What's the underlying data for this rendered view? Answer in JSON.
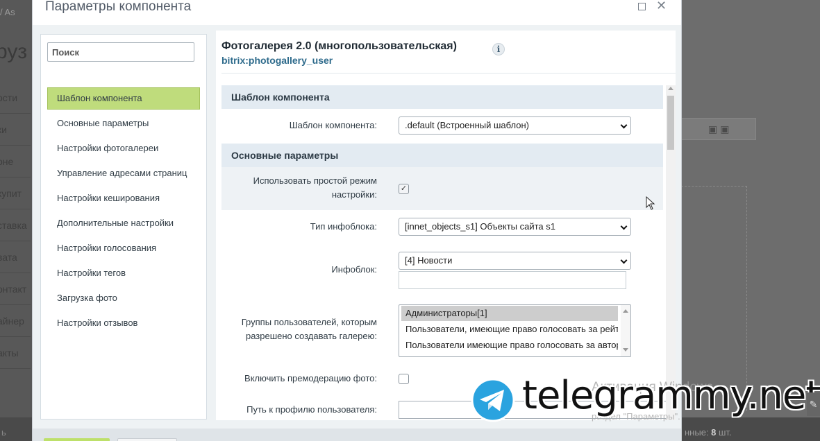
{
  "background": {
    "breadcrumb": "/ As",
    "heading": "руз",
    "nav_items": [
      "ости",
      "ки",
      "оне",
      "купит",
      "ставка",
      "вата",
      "онтакт",
      "айнер",
      "акты"
    ],
    "bottom_left": "ь",
    "bottom_right_prefix": "нные:",
    "bottom_right_value": "8",
    "bottom_right_suffix": "шт."
  },
  "dialog": {
    "title": "Параметры компонента",
    "search_placeholder": "Поиск",
    "nav": [
      {
        "label": "Шаблон компонента",
        "active": true
      },
      {
        "label": "Основные параметры",
        "active": false
      },
      {
        "label": "Настройки фотогалереи",
        "active": false
      },
      {
        "label": "Управление адресами страниц",
        "active": false
      },
      {
        "label": "Настройки кеширования",
        "active": false
      },
      {
        "label": "Дополнительные настройки",
        "active": false
      },
      {
        "label": "Настройки голосования",
        "active": false
      },
      {
        "label": "Настройки тегов",
        "active": false
      },
      {
        "label": "Загрузка фото",
        "active": false
      },
      {
        "label": "Настройки отзывов",
        "active": false
      }
    ],
    "component_title": "Фотогалерея 2.0 (многопользовательская)",
    "component_code": "bitrix:photogallery_user",
    "info_glyph": "i",
    "sections": {
      "template": {
        "header": "Шаблон компонента",
        "template_label": "Шаблон компонента:",
        "template_value": ".default (Встроенный шаблон)"
      },
      "main": {
        "header": "Основные параметры",
        "simple_mode_label": "Использовать простой режим настройки:",
        "simple_mode_checked": true,
        "check_glyph": "✓",
        "iblock_type_label": "Тип инфоблока:",
        "iblock_type_value": "[innet_objects_s1] Объекты сайта s1",
        "iblock_label": "Инфоблок:",
        "iblock_value": "[4] Новости",
        "groups_label": "Группы пользователей, которым разрешено создавать галерею:",
        "groups_options": [
          {
            "label": "Администраторы[1]",
            "selected": true
          },
          {
            "label": "Пользователи, имеющие право голосовать за рейтинг",
            "selected": false
          },
          {
            "label": "Пользователи имеющие право голосовать за авторитет",
            "selected": false
          }
        ],
        "premoderation_label": "Включить премодерацию фото:",
        "premoderation_checked": false,
        "profile_path_label": "Путь к профилю пользователя:"
      }
    }
  },
  "overlay": {
    "watermark_line1": "Активация Windows",
    "watermark_line2": "раздел \"Параметры\".",
    "telegram_text": "telegrammy.net",
    "tools_glyph": "✎"
  },
  "colors": {
    "active_nav": "#bfdc7c",
    "section_header": "#e3ebf2",
    "component_code": "#2d6a8b",
    "telegram_blue": "#2aa3df"
  }
}
